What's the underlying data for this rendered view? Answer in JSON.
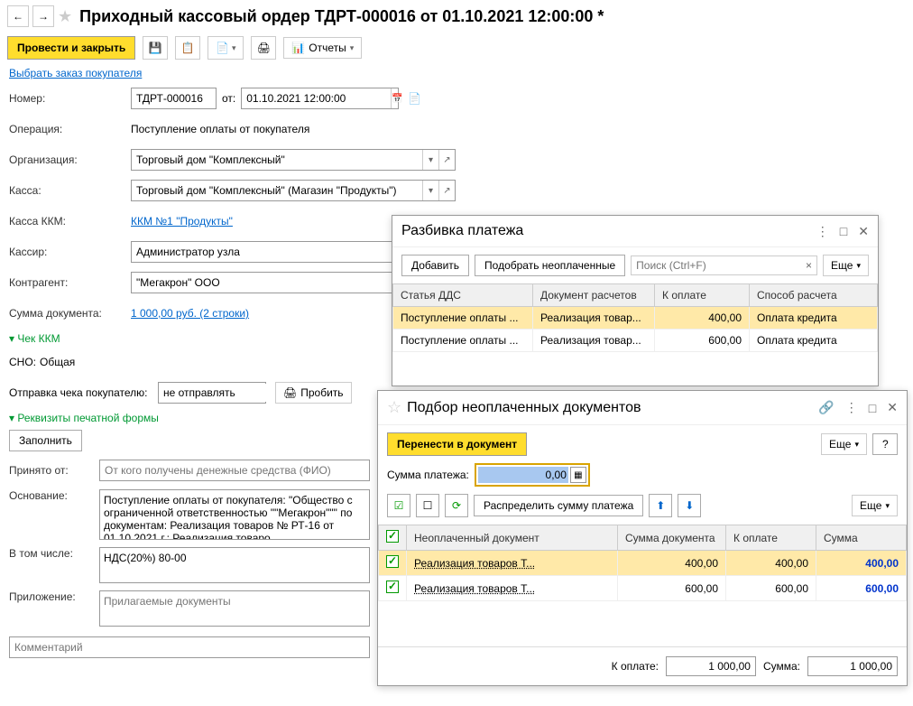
{
  "title": "Приходный кассовый ордер ТДРТ-000016 от 01.10.2021 12:00:00 *",
  "tb": {
    "post": "Провести и закрыть",
    "reports": "Отчеты"
  },
  "link_order": "Выбрать заказ покупателя",
  "f": {
    "num_l": "Номер:",
    "num": "ТДРТ-000016",
    "from_l": "от:",
    "date": "01.10.2021 12:00:00",
    "op_l": "Операция:",
    "op": "Поступление оплаты от покупателя",
    "org_l": "Организация:",
    "org": "Торговый дом \"Комплексный\"",
    "kassa_l": "Касса:",
    "kassa": "Торговый дом \"Комплексный\" (Магазин \"Продукты\")",
    "kkm_l": "Касса ККМ:",
    "kkm": "ККМ №1 \"Продукты\"",
    "cashier_l": "Кассир:",
    "cashier": "Администратор узла",
    "contr_l": "Контрагент:",
    "contr": "\"Мегакрон\" ООО",
    "sum_l": "Сумма документа:",
    "sum": "1 000,00 руб.  (2 строки)",
    "chek": "Чек ККМ",
    "sno_l": "СНО:",
    "sno": "Общая",
    "send_l": "Отправка чека покупателю:",
    "send": "не отправлять",
    "punch": "Пробить",
    "rekv": "Реквизиты печатной формы",
    "fill": "Заполнить",
    "from_who_l": "Принято от:",
    "from_who_ph": "От кого получены денежные средства (ФИО)",
    "base_l": "Основание:",
    "base": "Поступление оплаты от покупателя: \"Общество с ограниченной ответственностью \"\"Мегакрон\"\"\" по документам: Реализация товаров № РТ-16 от 01.10.2021 г.; Реализация товаро",
    "incl_l": "В том числе:",
    "incl": "НДС(20%) 80-00",
    "att_l": "Приложение:",
    "att_ph": "Прилагаемые документы",
    "comm_ph": "Комментарий"
  },
  "p1": {
    "title": "Разбивка платежа",
    "add": "Добавить",
    "pick": "Подобрать неоплаченные",
    "search_ph": "Поиск (Ctrl+F)",
    "more": "Еще",
    "cols": [
      "Статья ДДС",
      "Документ расчетов",
      "К оплате",
      "Способ расчета"
    ],
    "rows": [
      {
        "dds": "Поступление оплаты ...",
        "doc": "Реализация товар...",
        "amt": "400,00",
        "way": "Оплата кредита"
      },
      {
        "dds": "Поступление оплаты ...",
        "doc": "Реализация товар...",
        "amt": "600,00",
        "way": "Оплата кредита"
      }
    ]
  },
  "p2": {
    "title": "Подбор неоплаченных документов",
    "transfer": "Перенести в документ",
    "more": "Еще",
    "sum_l": "Сумма платежа:",
    "sum": "0,00",
    "dist": "Распределить сумму платежа",
    "cols": [
      "Неоплаченный документ",
      "Сумма документа",
      "К оплате",
      "Сумма"
    ],
    "rows": [
      {
        "doc": "Реализация товаров Т...",
        "sd": "400,00",
        "pay": "400,00",
        "sum": "400,00"
      },
      {
        "doc": "Реализация товаров Т...",
        "sd": "600,00",
        "pay": "600,00",
        "sum": "600,00"
      }
    ],
    "ftr_pay_l": "К оплате:",
    "ftr_pay": "1 000,00",
    "ftr_sum_l": "Сумма:",
    "ftr_sum": "1 000,00"
  }
}
